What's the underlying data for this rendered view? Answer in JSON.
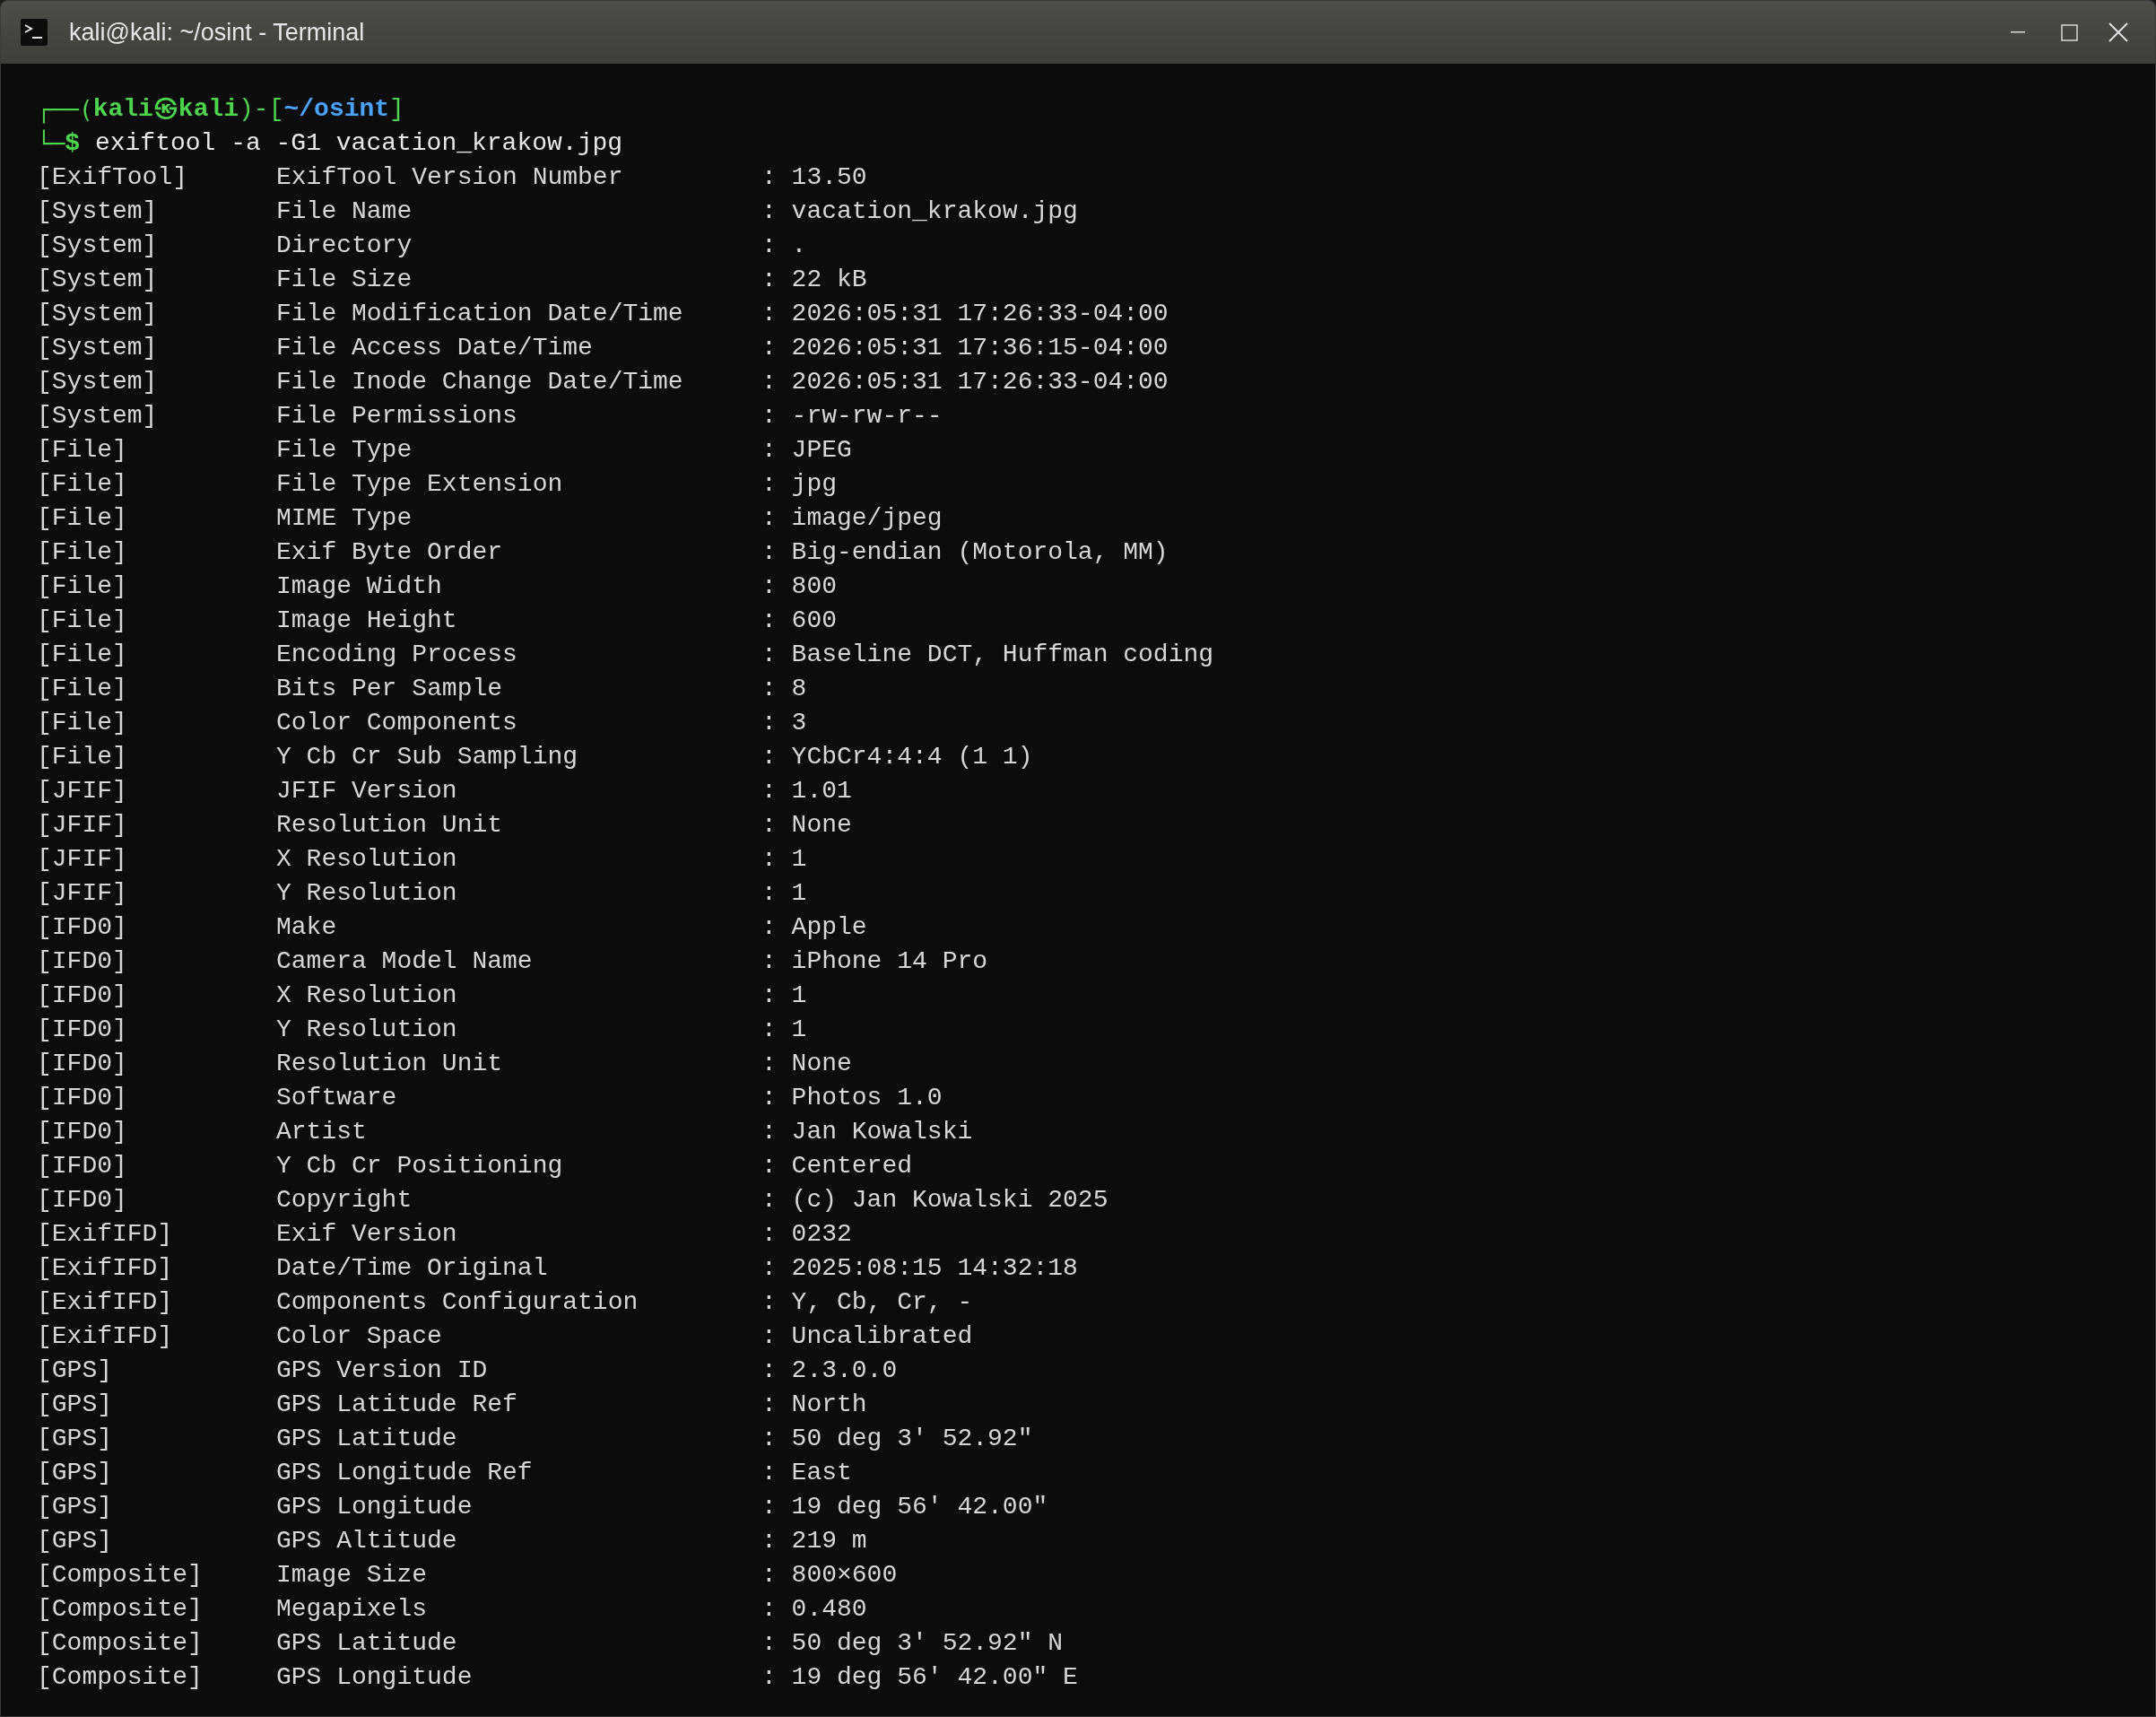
{
  "window": {
    "title": "kali@kali: ~/osint - Terminal"
  },
  "prompt": {
    "line1_start": "┌──(",
    "user_host": "kali㉿kali",
    "line1_mid": ")-[",
    "cwd": "~/osint",
    "line1_end": "]",
    "line2_start": "└─",
    "symbol": "$",
    "command": "exiftool -a -G1 vacation_krakow.jpg"
  },
  "rows": [
    {
      "group": "[ExifTool]",
      "tag": "ExifTool Version Number",
      "value": ": 13.50"
    },
    {
      "group": "[System]",
      "tag": "File Name",
      "value": ": vacation_krakow.jpg"
    },
    {
      "group": "[System]",
      "tag": "Directory",
      "value": ": ."
    },
    {
      "group": "[System]",
      "tag": "File Size",
      "value": ": 22 kB"
    },
    {
      "group": "[System]",
      "tag": "File Modification Date/Time",
      "value": ": 2026:05:31 17:26:33-04:00"
    },
    {
      "group": "[System]",
      "tag": "File Access Date/Time",
      "value": ": 2026:05:31 17:36:15-04:00"
    },
    {
      "group": "[System]",
      "tag": "File Inode Change Date/Time",
      "value": ": 2026:05:31 17:26:33-04:00"
    },
    {
      "group": "[System]",
      "tag": "File Permissions",
      "value": ": -rw-rw-r--"
    },
    {
      "group": "[File]",
      "tag": "File Type",
      "value": ": JPEG"
    },
    {
      "group": "[File]",
      "tag": "File Type Extension",
      "value": ": jpg"
    },
    {
      "group": "[File]",
      "tag": "MIME Type",
      "value": ": image/jpeg"
    },
    {
      "group": "[File]",
      "tag": "Exif Byte Order",
      "value": ": Big-endian (Motorola, MM)"
    },
    {
      "group": "[File]",
      "tag": "Image Width",
      "value": ": 800"
    },
    {
      "group": "[File]",
      "tag": "Image Height",
      "value": ": 600"
    },
    {
      "group": "[File]",
      "tag": "Encoding Process",
      "value": ": Baseline DCT, Huffman coding"
    },
    {
      "group": "[File]",
      "tag": "Bits Per Sample",
      "value": ": 8"
    },
    {
      "group": "[File]",
      "tag": "Color Components",
      "value": ": 3"
    },
    {
      "group": "[File]",
      "tag": "Y Cb Cr Sub Sampling",
      "value": ": YCbCr4:4:4 (1 1)"
    },
    {
      "group": "[JFIF]",
      "tag": "JFIF Version",
      "value": ": 1.01"
    },
    {
      "group": "[JFIF]",
      "tag": "Resolution Unit",
      "value": ": None"
    },
    {
      "group": "[JFIF]",
      "tag": "X Resolution",
      "value": ": 1"
    },
    {
      "group": "[JFIF]",
      "tag": "Y Resolution",
      "value": ": 1"
    },
    {
      "group": "[IFD0]",
      "tag": "Make",
      "value": ": Apple"
    },
    {
      "group": "[IFD0]",
      "tag": "Camera Model Name",
      "value": ": iPhone 14 Pro"
    },
    {
      "group": "[IFD0]",
      "tag": "X Resolution",
      "value": ": 1"
    },
    {
      "group": "[IFD0]",
      "tag": "Y Resolution",
      "value": ": 1"
    },
    {
      "group": "[IFD0]",
      "tag": "Resolution Unit",
      "value": ": None"
    },
    {
      "group": "[IFD0]",
      "tag": "Software",
      "value": ": Photos 1.0"
    },
    {
      "group": "[IFD0]",
      "tag": "Artist",
      "value": ": Jan Kowalski"
    },
    {
      "group": "[IFD0]",
      "tag": "Y Cb Cr Positioning",
      "value": ": Centered"
    },
    {
      "group": "[IFD0]",
      "tag": "Copyright",
      "value": ": (c) Jan Kowalski 2025"
    },
    {
      "group": "[ExifIFD]",
      "tag": "Exif Version",
      "value": ": 0232"
    },
    {
      "group": "[ExifIFD]",
      "tag": "Date/Time Original",
      "value": ": 2025:08:15 14:32:18"
    },
    {
      "group": "[ExifIFD]",
      "tag": "Components Configuration",
      "value": ": Y, Cb, Cr, -"
    },
    {
      "group": "[ExifIFD]",
      "tag": "Color Space",
      "value": ": Uncalibrated"
    },
    {
      "group": "[GPS]",
      "tag": "GPS Version ID",
      "value": ": 2.3.0.0"
    },
    {
      "group": "[GPS]",
      "tag": "GPS Latitude Ref",
      "value": ": North"
    },
    {
      "group": "[GPS]",
      "tag": "GPS Latitude",
      "value": ": 50 deg 3' 52.92\""
    },
    {
      "group": "[GPS]",
      "tag": "GPS Longitude Ref",
      "value": ": East"
    },
    {
      "group": "[GPS]",
      "tag": "GPS Longitude",
      "value": ": 19 deg 56' 42.00\""
    },
    {
      "group": "[GPS]",
      "tag": "GPS Altitude",
      "value": ": 219 m"
    },
    {
      "group": "[Composite]",
      "tag": "Image Size",
      "value": ": 800×600"
    },
    {
      "group": "[Composite]",
      "tag": "Megapixels",
      "value": ": 0.480"
    },
    {
      "group": "[Composite]",
      "tag": "GPS Latitude",
      "value": ": 50 deg 3' 52.92\" N"
    },
    {
      "group": "[Composite]",
      "tag": "GPS Longitude",
      "value": ": 19 deg 56' 42.00\" E"
    }
  ]
}
